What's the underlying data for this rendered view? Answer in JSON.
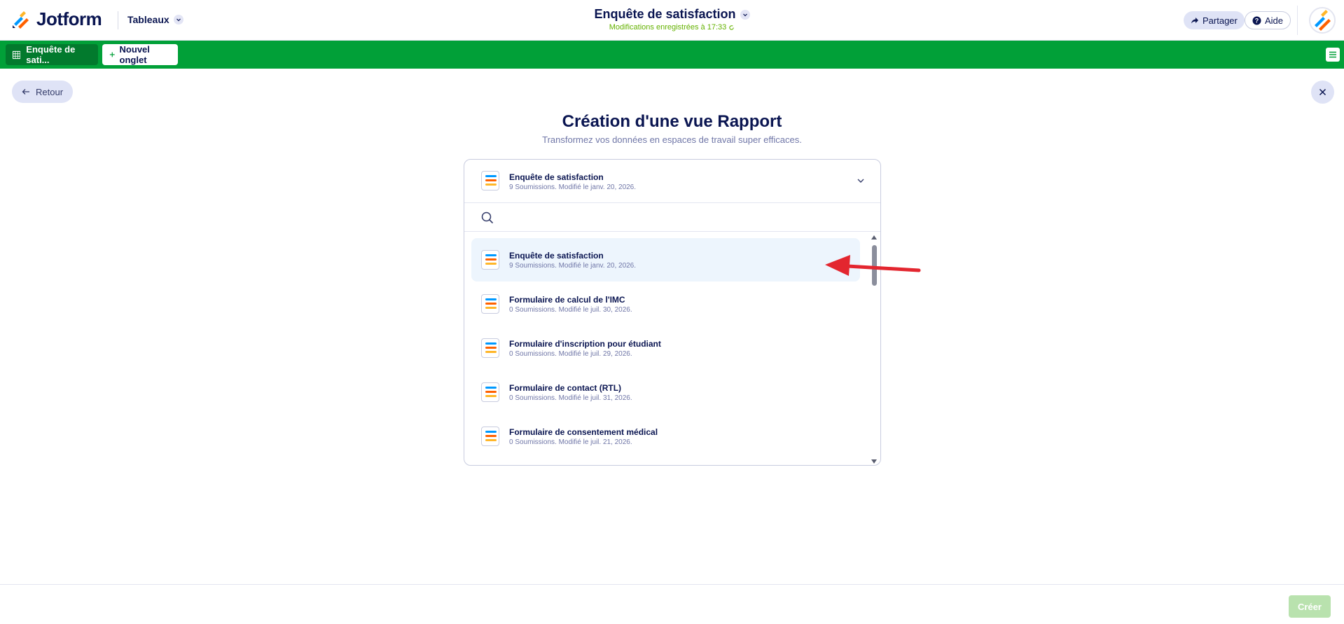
{
  "header": {
    "brand": "Jotform",
    "workspace_label": "Tableaux",
    "doc_title": "Enquête de satisfaction",
    "save_status": "Modifications enregistrées à 17:33",
    "share_label": "Partager",
    "help_label": "Aide"
  },
  "tabs": {
    "active_label": "Enquête de sati...",
    "new_tab_label": "Nouvel onglet"
  },
  "nav": {
    "back_label": "Retour"
  },
  "main": {
    "heading": "Création d'une vue Rapport",
    "subheading": "Transformez vos données en espaces de travail super efficaces."
  },
  "selector": {
    "selected": {
      "title": "Enquête de satisfaction",
      "meta": "9 Soumissions. Modifié le janv. 20, 2026."
    },
    "search_placeholder": "",
    "items": [
      {
        "title": "Enquête de satisfaction",
        "meta": "9 Soumissions. Modifié le janv. 20, 2026."
      },
      {
        "title": "Formulaire de calcul de l'IMC",
        "meta": "0 Soumissions. Modifié le juil. 30, 2026."
      },
      {
        "title": "Formulaire d'inscription pour étudiant",
        "meta": "0 Soumissions. Modifié le juil. 29, 2026."
      },
      {
        "title": "Formulaire de contact (RTL)",
        "meta": "0 Soumissions. Modifié le juil. 31, 2026."
      },
      {
        "title": "Formulaire de consentement médical",
        "meta": "0 Soumissions. Modifié le juil. 21, 2026."
      }
    ]
  },
  "footer": {
    "create_label": "Créer"
  },
  "colors": {
    "accent_green": "#01a038",
    "dark_green": "#027a2d",
    "navy": "#0a1551",
    "annotation_red": "#e3262f"
  }
}
